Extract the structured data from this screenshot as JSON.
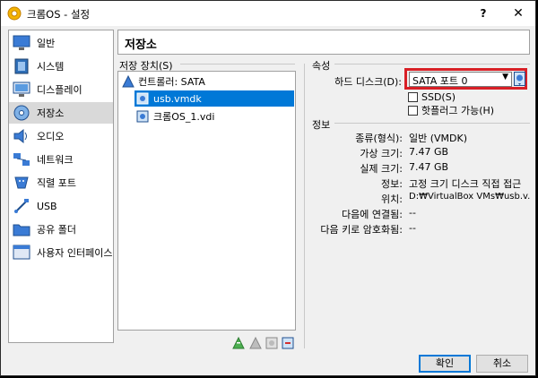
{
  "window": {
    "title": "크롬OS - 설정",
    "help": "?",
    "close": "✕"
  },
  "sidebar": {
    "items": [
      {
        "label": "일반"
      },
      {
        "label": "시스템"
      },
      {
        "label": "디스플레이"
      },
      {
        "label": "저장소"
      },
      {
        "label": "오디오"
      },
      {
        "label": "네트워크"
      },
      {
        "label": "직렬 포트"
      },
      {
        "label": "USB"
      },
      {
        "label": "공유 폴더"
      },
      {
        "label": "사용자 인터페이스"
      }
    ]
  },
  "page": {
    "title": "저장소"
  },
  "storage": {
    "label": "저장 장치(S)",
    "controller": "컨트롤러: SATA",
    "items": [
      {
        "label": "usb.vmdk"
      },
      {
        "label": "크롬OS_1.vdi"
      }
    ]
  },
  "attributes": {
    "label": "속성",
    "hdd_label": "하드 디스크(D):",
    "hdd_value": "SATA 포트 0",
    "ssd_label": "SSD(S)",
    "hotplug_label": "핫플러그 가능(H)"
  },
  "info": {
    "label": "정보",
    "rows": [
      {
        "key": "종류(형식):",
        "value": "일반 (VMDK)"
      },
      {
        "key": "가상 크기:",
        "value": "7.47 GB"
      },
      {
        "key": "실제 크기:",
        "value": "7.47 GB"
      },
      {
        "key": "정보:",
        "value": "고정 크기 디스크 직접 접근"
      },
      {
        "key": "위치:",
        "value": "D:₩VirtualBox VMs₩usb.v..."
      },
      {
        "key": "다음에 연결됨:",
        "value": "--"
      },
      {
        "key": "다음 키로 암호화됨:",
        "value": "--"
      }
    ]
  },
  "buttons": {
    "ok": "확인",
    "cancel": "취소"
  },
  "colors": {
    "selection": "#0078d7",
    "highlight": "#d81f26"
  }
}
